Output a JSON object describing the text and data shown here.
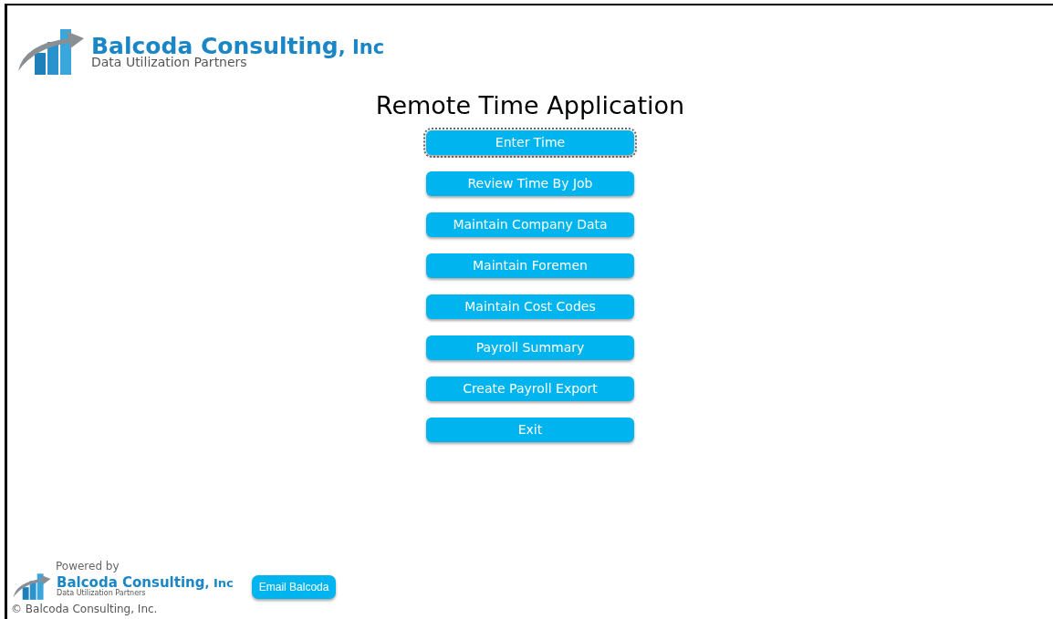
{
  "header_logo": {
    "name": "Balcoda Consulting",
    "suffix": ", Inc",
    "tagline": "Data Utilization Partners"
  },
  "title": "Remote Time Application",
  "menu_buttons": [
    {
      "label": "Enter Time",
      "selected": true
    },
    {
      "label": "Review Time By Job",
      "selected": false
    },
    {
      "label": "Maintain Company Data",
      "selected": false
    },
    {
      "label": "Maintain Foremen",
      "selected": false
    },
    {
      "label": "Maintain Cost Codes",
      "selected": false
    },
    {
      "label": "Payroll Summary",
      "selected": false
    },
    {
      "label": "Create Payroll Export",
      "selected": false
    },
    {
      "label": "Exit",
      "selected": false
    }
  ],
  "footer": {
    "powered_by": "Powered by",
    "logo": {
      "name": "Balcoda Consulting",
      "suffix": ", Inc",
      "tagline": "Data Utilization Partners"
    },
    "email_button": "Email Balcoda",
    "copyright": "© Balcoda Consulting, Inc."
  }
}
